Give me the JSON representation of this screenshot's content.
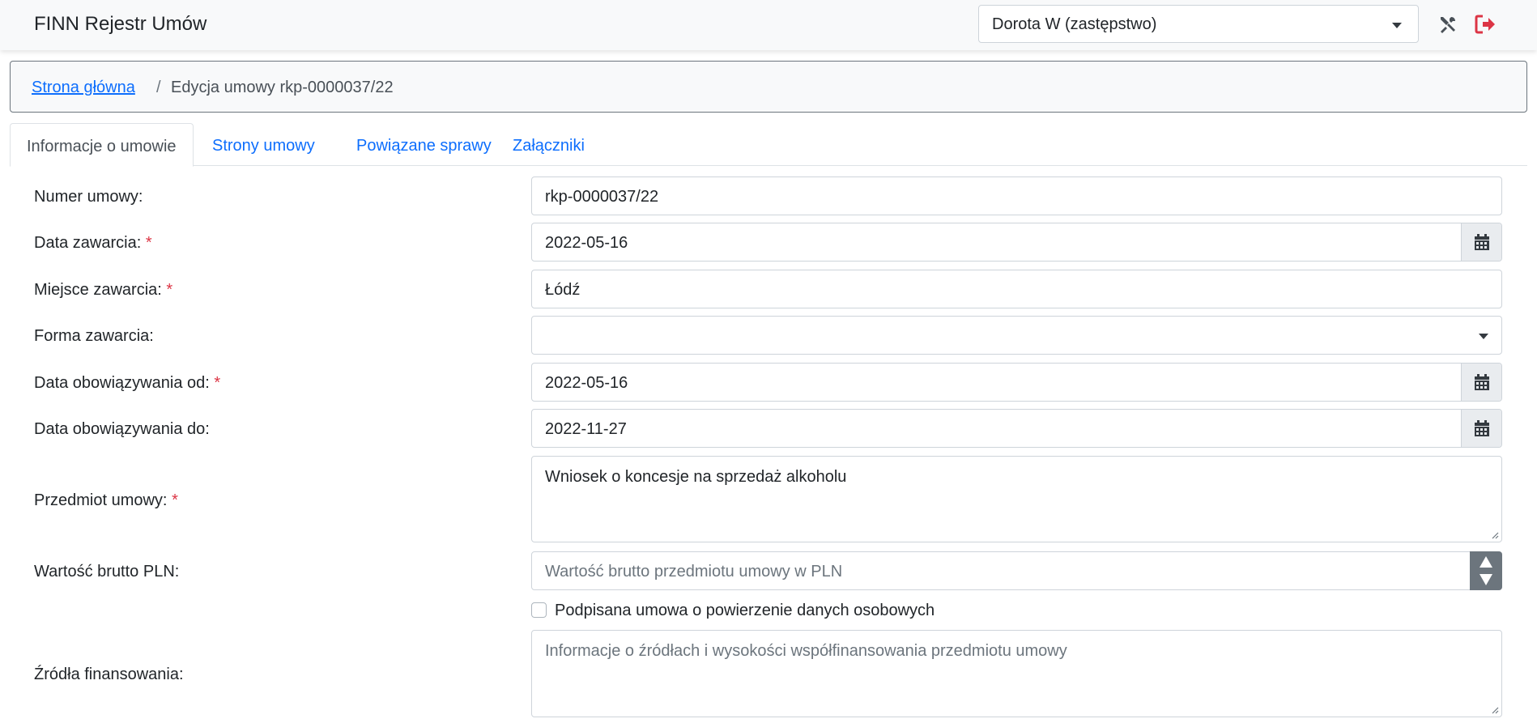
{
  "header": {
    "app_title": "FINN Rejestr Umów",
    "user_select_value": "Dorota W (zastępstwo)"
  },
  "breadcrumb": {
    "home": "Strona główna",
    "separator": "/",
    "current": "Edycja umowy rkp-0000037/22"
  },
  "tabs": [
    {
      "label": "Informacje o umowie",
      "active": true
    },
    {
      "label": "Strony umowy",
      "active": false
    },
    {
      "label": "Powiązane sprawy",
      "active": false
    },
    {
      "label": "Załączniki",
      "active": false
    }
  ],
  "form": {
    "numer_umowy": {
      "label": "Numer umowy:",
      "value": "rkp-0000037/22"
    },
    "data_zawarcia": {
      "label": "Data zawarcia:",
      "required": "*",
      "value": "2022-05-16"
    },
    "miejsce_zawarcia": {
      "label": "Miejsce zawarcia:",
      "required": "*",
      "value": "Łódź"
    },
    "forma_zawarcia": {
      "label": "Forma zawarcia:",
      "value": ""
    },
    "data_od": {
      "label": "Data obowiązywania od:",
      "required": "*",
      "value": "2022-05-16"
    },
    "data_do": {
      "label": "Data obowiązywania do:",
      "value": "2022-11-27"
    },
    "przedmiot": {
      "label": "Przedmiot umowy:",
      "required": "*",
      "value": "Wniosek o koncesje na sprzedaż alkoholu"
    },
    "wartosc": {
      "label": "Wartość brutto PLN:",
      "placeholder": "Wartość brutto przedmiotu umowy w PLN"
    },
    "powierzenie": {
      "label": "Podpisana umowa o powierzenie danych osobowych",
      "checked": false
    },
    "zrodla": {
      "label": "Źródła finansowania:",
      "placeholder": "Informacje o źródłach i wysokości współfinansowania przedmiotu umowy"
    }
  },
  "colors": {
    "link": "#0d6efd",
    "required": "#dc3545",
    "logout": "#dc3545",
    "spinner": "#6c757d"
  },
  "icons": [
    "tools-icon",
    "logout-icon",
    "calendar-icon",
    "chevron-down-icon"
  ]
}
